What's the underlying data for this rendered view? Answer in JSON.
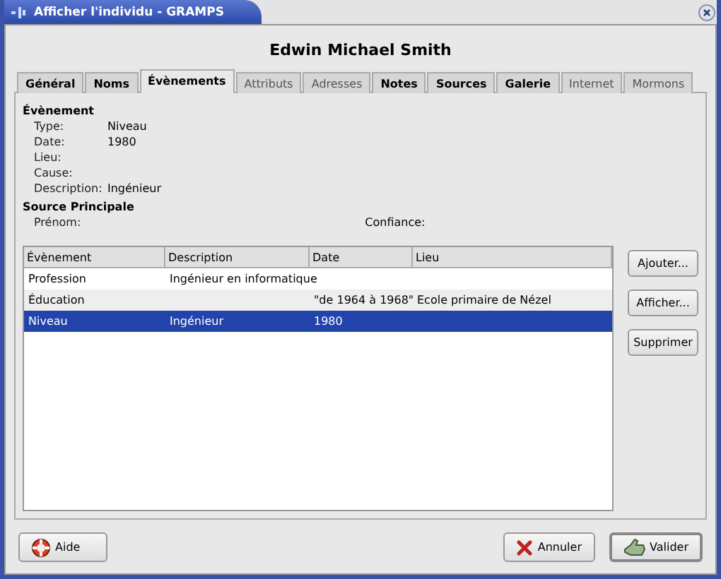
{
  "window": {
    "title": "Afficher l'individu - GRAMPS"
  },
  "person_name": "Edwin Michael Smith",
  "tabs": [
    {
      "label": "Général",
      "selected": false,
      "has_content": true
    },
    {
      "label": "Noms",
      "selected": false,
      "has_content": true
    },
    {
      "label": "Évènements",
      "selected": true,
      "has_content": true
    },
    {
      "label": "Attributs",
      "selected": false,
      "has_content": false
    },
    {
      "label": "Adresses",
      "selected": false,
      "has_content": false
    },
    {
      "label": "Notes",
      "selected": false,
      "has_content": true
    },
    {
      "label": "Sources",
      "selected": false,
      "has_content": true
    },
    {
      "label": "Galerie",
      "selected": false,
      "has_content": true
    },
    {
      "label": "Internet",
      "selected": false,
      "has_content": false
    },
    {
      "label": "Mormons",
      "selected": false,
      "has_content": false
    }
  ],
  "event_section": {
    "heading": "Évènement",
    "fields": [
      {
        "label": "Type:",
        "value": "Niveau"
      },
      {
        "label": "Date:",
        "value": "1980"
      },
      {
        "label": "Lieu:"
      },
      {
        "label": "Cause:"
      },
      {
        "label": "Description:",
        "value": "Ingénieur"
      }
    ]
  },
  "source_section": {
    "heading": "Source Principale",
    "first_name_label": "Prénom:",
    "confidence_label": "Confiance:"
  },
  "table": {
    "columns": [
      "Évènement",
      "Description",
      "Date",
      "Lieu"
    ],
    "rows": [
      {
        "cells": [
          "Profession",
          "Ingénieur en informatique",
          "",
          ""
        ],
        "selected": false
      },
      {
        "cells": [
          "Éducation",
          "",
          "\"de 1964 à 1968\"",
          "Ecole primaire de Nézel"
        ],
        "selected": false
      },
      {
        "cells": [
          "Niveau",
          "Ingénieur",
          "1980",
          ""
        ],
        "selected": true
      }
    ]
  },
  "side_buttons": [
    "Ajouter...",
    "Afficher...",
    "Supprimer"
  ],
  "footer_buttons": [
    {
      "kind": "help",
      "label": "Aide"
    },
    {
      "kind": "cancel",
      "label": "Annuler"
    },
    {
      "kind": "ok",
      "label": "Valider"
    }
  ]
}
